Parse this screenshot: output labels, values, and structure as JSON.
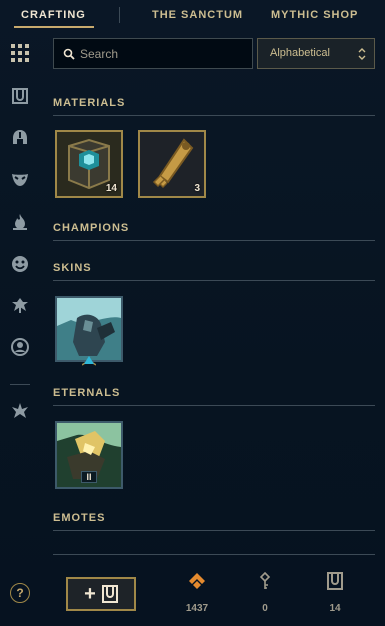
{
  "nav": {
    "tabs": [
      {
        "label": "CRAFTING"
      },
      {
        "label": "THE SANCTUM"
      },
      {
        "label": "MYTHIC SHOP"
      }
    ]
  },
  "sidebar": {
    "icons": [
      "grid-icon",
      "chest-icon",
      "helmet-icon",
      "mask-icon",
      "flame-icon",
      "emote-face-icon",
      "ward-icon",
      "profile-icon",
      "crest-icon"
    ],
    "help_label": "?"
  },
  "search": {
    "placeholder": "Search",
    "value": ""
  },
  "sort": {
    "selected": "Alphabetical"
  },
  "sections": {
    "materials": "MATERIALS",
    "champions": "CHAMPIONS",
    "skins": "SKINS",
    "eternals": "ETERNALS",
    "emotes": "EMOTES"
  },
  "materials": [
    {
      "name": "hextech-chest",
      "count": "14"
    },
    {
      "name": "key-fragment",
      "count": "3"
    }
  ],
  "eternals": [
    {
      "tier": "II"
    }
  ],
  "footer": {
    "add_label": "+",
    "currencies": [
      {
        "icon": "orange-essence-icon",
        "value": "1437"
      },
      {
        "icon": "key-icon",
        "value": "0"
      },
      {
        "icon": "chest-icon",
        "value": "14"
      }
    ]
  },
  "colors": {
    "gold": "#c8aa6e",
    "gold_dark": "#a08848",
    "text": "#cdbe91",
    "orange": "#e58b2f",
    "background": "#06111c"
  }
}
